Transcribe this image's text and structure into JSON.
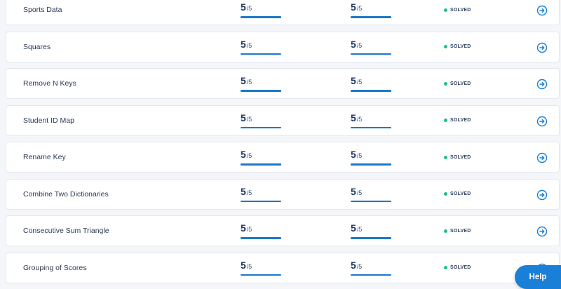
{
  "rows": [
    {
      "name": "Sports Data",
      "score1": "5",
      "max1": "/5",
      "score2": "5",
      "max2": "/5",
      "status": "SOLVED"
    },
    {
      "name": "Squares",
      "score1": "5",
      "max1": "/5",
      "score2": "5",
      "max2": "/5",
      "status": "SOLVED"
    },
    {
      "name": "Remove N Keys",
      "score1": "5",
      "max1": "/5",
      "score2": "5",
      "max2": "/5",
      "status": "SOLVED"
    },
    {
      "name": "Student ID Map",
      "score1": "5",
      "max1": "/5",
      "score2": "5",
      "max2": "/5",
      "status": "SOLVED"
    },
    {
      "name": "Rename Key",
      "score1": "5",
      "max1": "/5",
      "score2": "5",
      "max2": "/5",
      "status": "SOLVED"
    },
    {
      "name": "Combine Two Dictionaries",
      "score1": "5",
      "max1": "/5",
      "score2": "5",
      "max2": "/5",
      "status": "SOLVED"
    },
    {
      "name": "Consecutive Sum Triangle",
      "score1": "5",
      "max1": "/5",
      "score2": "5",
      "max2": "/5",
      "status": "SOLVED"
    },
    {
      "name": "Grouping of Scores",
      "score1": "5",
      "max1": "/5",
      "score2": "5",
      "max2": "/5",
      "status": "SOLVED"
    }
  ],
  "help_label": "Help",
  "icons": {
    "row_action": "arrow-circle-right-icon",
    "status": "status-dot-icon"
  },
  "colors": {
    "accent": "#1a7fd6",
    "solved": "#1fbf85",
    "score_bar": "#1c78c8"
  }
}
